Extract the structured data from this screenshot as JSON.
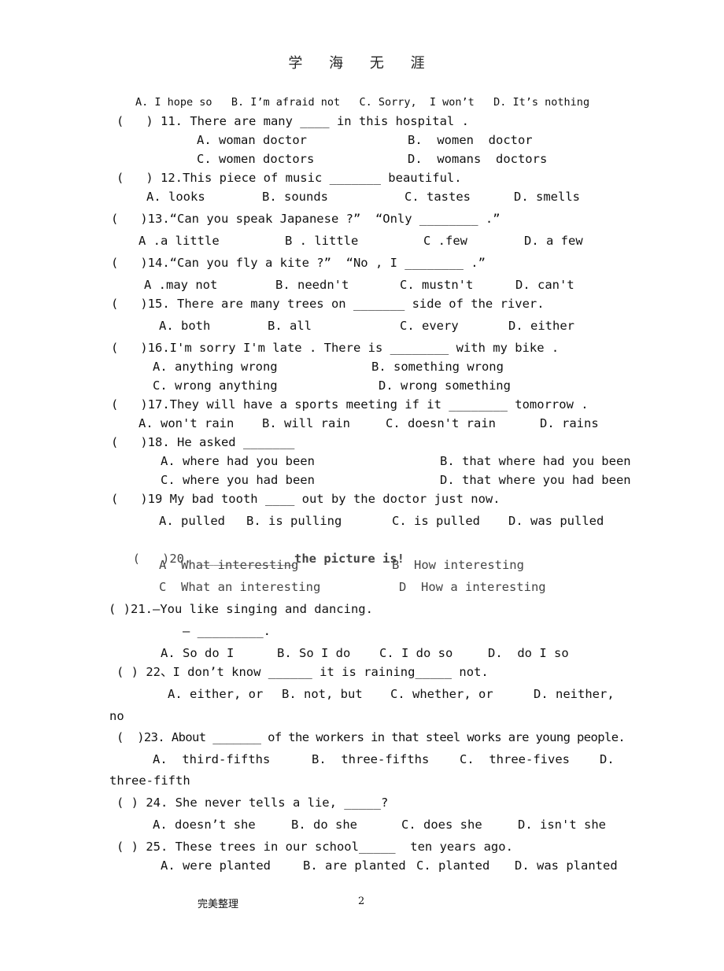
{
  "header": {
    "title": "学 海 无 涯"
  },
  "lines": [
    {
      "id": "q10-options",
      "text": "A. I hope so   B. I’m afraid not   C. Sorry,  I won’t   D. It’s nothing"
    },
    {
      "id": "q11",
      "text": "(   ) 11. There are many ____ in this hospital ."
    },
    {
      "id": "q11-ab",
      "a": "A. woman doctor",
      "b": "B.  women  doctor"
    },
    {
      "id": "q11-cd",
      "c": "C. women doctors",
      "d": "D.  womans  doctors"
    },
    {
      "id": "q12",
      "text": "(   ) 12.This piece of music _______ beautiful."
    },
    {
      "id": "q12-opts",
      "a": "A. looks",
      "b": "B. sounds",
      "c": "C. tastes",
      "d": "D. smells"
    },
    {
      "id": "q13",
      "text": "(   )13.“Can you speak Japanese ?”  “Only ________ .”"
    },
    {
      "id": "q13-opts",
      "a": "A .a little",
      "b": "B . little",
      "c": "C .few",
      "d": "D. a few"
    },
    {
      "id": "q14",
      "text": "(   )14.“Can you fly a kite ?”  “No , I ________ .”"
    },
    {
      "id": "q14-opts",
      "a": "A .may not",
      "b": "B. needn't",
      "c": "C. mustn't",
      "d": "D. can't"
    },
    {
      "id": "q15",
      "text": "(   )15. There are many trees on _______ side of the river."
    },
    {
      "id": "q15-opts",
      "a": "A. both",
      "b": "B. all",
      "c": "C. every",
      "d": "D. either"
    },
    {
      "id": "q16",
      "text": "(   )16.I'm sorry I'm late . There is ________ with my bike ."
    },
    {
      "id": "q16-ab",
      "a": "A. anything wrong",
      "b": "B. something wrong"
    },
    {
      "id": "q16-cd",
      "c": "C. wrong anything",
      "d": "D. wrong something"
    },
    {
      "id": "q17",
      "text": "(   )17.They will have a sports meeting if it ________ tomorrow ."
    },
    {
      "id": "q17-opts",
      "a": "A. won't rain",
      "b": "B. will rain",
      "c": "C. doesn't rain",
      "d": "D. rains"
    },
    {
      "id": "q18",
      "text": "(   )18. He asked _______"
    },
    {
      "id": "q18-ab",
      "a": "A. where had you been",
      "b": "B. that where had you been"
    },
    {
      "id": "q18-cd",
      "c": "C. where you had been",
      "d": "D. that where you had been"
    },
    {
      "id": "q19",
      "text": "(   )19 My bad tooth ____ out by the doctor just now."
    },
    {
      "id": "q19-opts",
      "a": "A. pulled",
      "b": "B. is pulling",
      "c": "C. is pulled",
      "d": "D. was pulled"
    },
    {
      "id": "q20",
      "prefix": "(   )20. ",
      "blank": "_____________",
      "suffix": "the picture is!"
    },
    {
      "id": "q20-ab",
      "a": "A  What interesting",
      "b": "B  How interesting"
    },
    {
      "id": "q20-cd",
      "c": "C  What an interesting",
      "d": "D  How a interesting"
    },
    {
      "id": "q21",
      "text": "( )21.—You like singing and dancing."
    },
    {
      "id": "q21-reply",
      "text": "— _________."
    },
    {
      "id": "q21-opts",
      "a": "A. So do I",
      "b": "B. So I do",
      "c": "C. I do so",
      "d": "D.  do I so"
    },
    {
      "id": "q22",
      "text": "( ) 22、I don’t know ______ it is raining_____ not."
    },
    {
      "id": "q22-opts",
      "a": "A. either, or",
      "b": "B. not, but",
      "c": "C. whether, or",
      "d": "D. neither,"
    },
    {
      "id": "q22-wrap",
      "text": "no"
    },
    {
      "id": "q23",
      "text": "(  )23. About _______ of the workers in that steel works are young people."
    },
    {
      "id": "q23-opts",
      "a": "A.  third-fifths",
      "b": "B.  three-fifths",
      "c": "C.  three-fives",
      "d": "D."
    },
    {
      "id": "q23-wrap",
      "text": "three-fifth"
    },
    {
      "id": "q24",
      "text": "( ) 24. She never tells a lie, _____?"
    },
    {
      "id": "q24-opts",
      "a": "A. doesn’t she",
      "b": "B. do she",
      "c": "C. does she",
      "d": "D. isn't she"
    },
    {
      "id": "q25",
      "text": "( ) 25. These trees in our school_____  ten years ago."
    },
    {
      "id": "q25-opts",
      "a": "A. were planted",
      "b": "B. are planted",
      "c": "C. planted",
      "d": "D. was planted"
    }
  ],
  "footer": {
    "label": "完美整理",
    "page_number": "2"
  }
}
